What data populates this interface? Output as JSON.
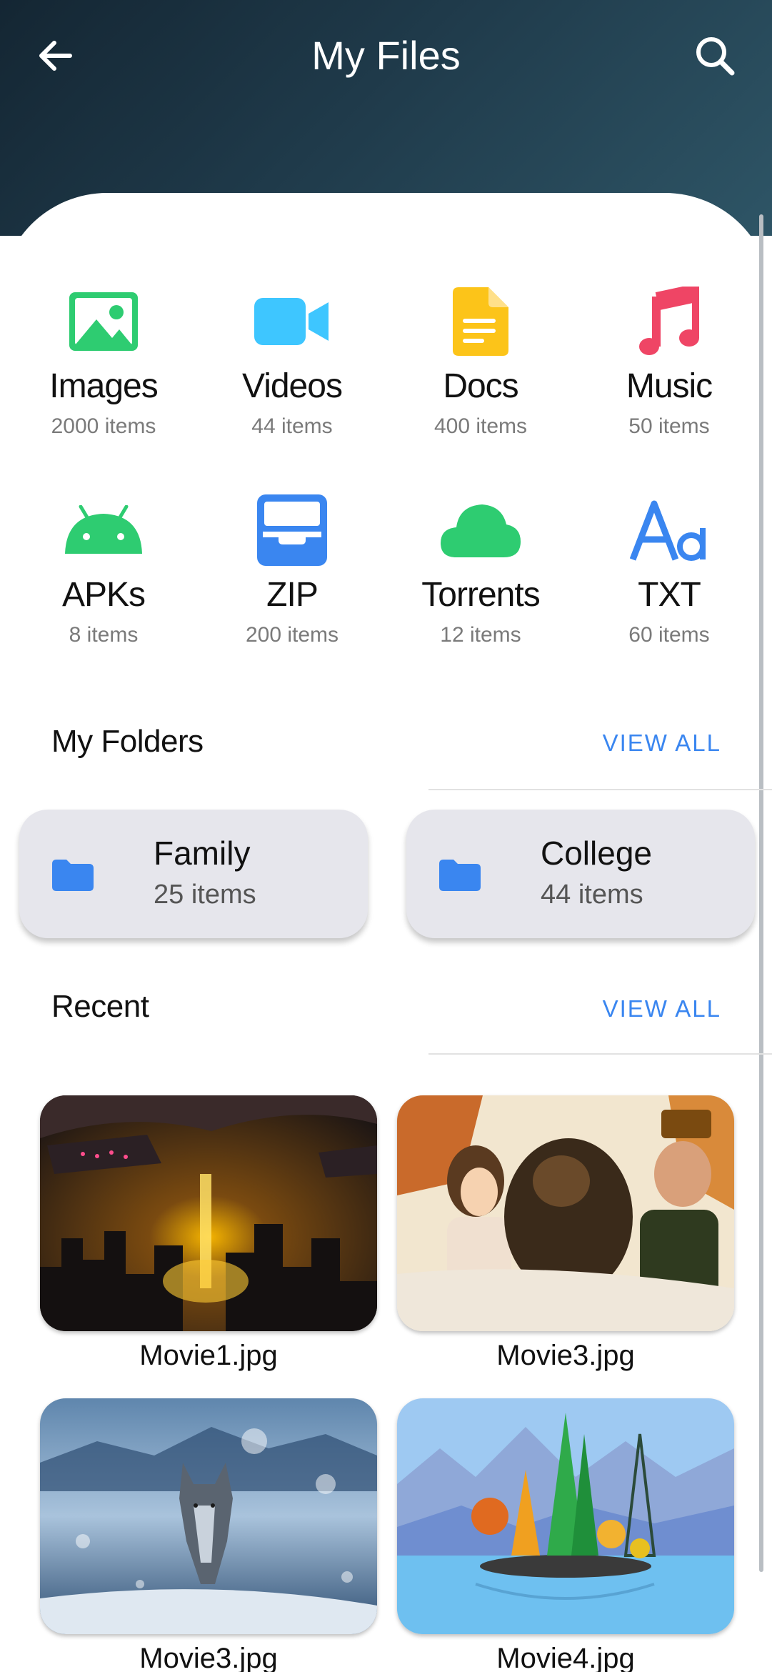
{
  "header": {
    "title": "My Files",
    "back_icon": "arrow-left-icon",
    "search_icon": "search-icon"
  },
  "categories": [
    {
      "label": "Images",
      "count": "2000 items",
      "icon": "image-icon",
      "color": "#2ecc71"
    },
    {
      "label": "Videos",
      "count": "44 items",
      "icon": "video-camera-icon",
      "color": "#3ec6ff"
    },
    {
      "label": "Docs",
      "count": "400 items",
      "icon": "document-icon",
      "color": "#fcc419"
    },
    {
      "label": "Music",
      "count": "50 items",
      "icon": "music-note-icon",
      "color": "#ef4565"
    },
    {
      "label": "APKs",
      "count": "8 items",
      "icon": "android-icon",
      "color": "#2ecc71"
    },
    {
      "label": "ZIP",
      "count": "200 items",
      "icon": "archive-tray-icon",
      "color": "#3a86f0"
    },
    {
      "label": "Torrents",
      "count": "12 items",
      "icon": "cloud-icon",
      "color": "#2ecc71"
    },
    {
      "label": "TXT",
      "count": "60 items",
      "icon": "text-font-icon",
      "color": "#3a86f0"
    }
  ],
  "folders_section": {
    "title": "My Folders",
    "view_all": "VIEW ALL",
    "items": [
      {
        "name": "Family",
        "count": "25 items",
        "icon": "folder-icon"
      },
      {
        "name": "College",
        "count": "44 items",
        "icon": "folder-icon"
      }
    ]
  },
  "recent_section": {
    "title": "Recent",
    "view_all": "VIEW ALL",
    "items": [
      {
        "name": "Movie1.jpg"
      },
      {
        "name": "Movie3.jpg"
      },
      {
        "name": "Movie3.jpg"
      },
      {
        "name": "Movie4.jpg"
      }
    ]
  },
  "colors": {
    "accent": "#3a86f0",
    "header_gradient_start": "#142633",
    "header_gradient_end": "#2e5566"
  }
}
